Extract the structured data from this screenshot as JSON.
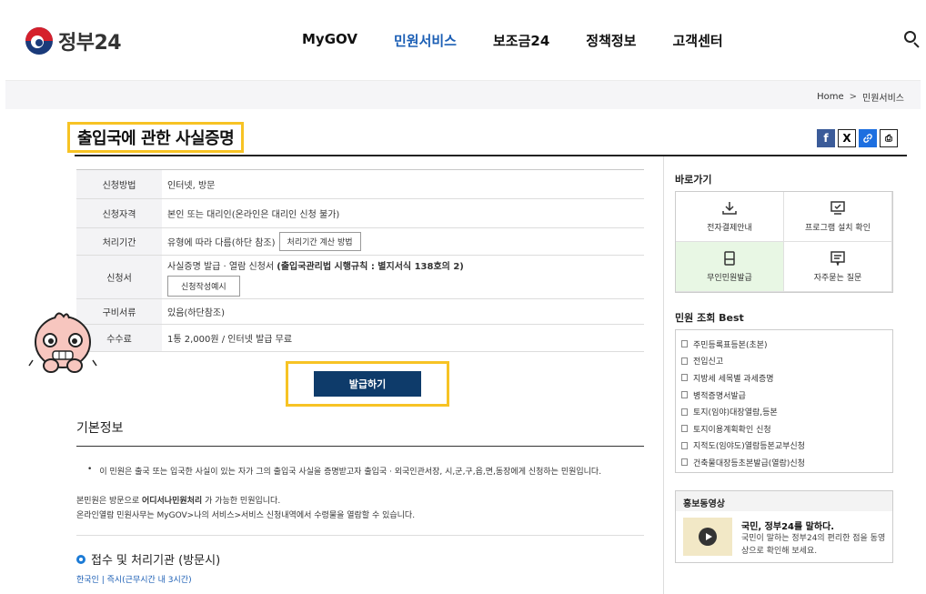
{
  "header": {
    "logo_text": "정부24",
    "nav": [
      "MyGOV",
      "민원서비스",
      "보조금24",
      "정책정보",
      "고객센터"
    ],
    "active_nav_index": 1
  },
  "breadcrumb": {
    "home": "Home",
    "separator": ">",
    "current": "민원서비스"
  },
  "page_title": "출입국에 관한 사실증명",
  "share": {
    "print": "⎙"
  },
  "info_table": {
    "method_label": "신청방법",
    "method_value": "인터넷, 방문",
    "qualification_label": "신청자격",
    "qualification_value": "본인 또는 대리인(온라인은 대리인 신청 불가)",
    "period_label": "처리기간",
    "period_value": "유형에 따라 다름(하단 참조)",
    "period_button": "처리기간 계산 방법",
    "form_label": "신청서",
    "form_value_prefix": "사실증명 발급 · 열람 신청서 ",
    "form_value_bold": "(출입국관리법 시행규칙 : 별지서식 138호의 2)",
    "form_button": "신청작성예시",
    "docs_label": "구비서류",
    "docs_value": "있음(하단참조)",
    "fee_label": "수수료",
    "fee_value": "1통 2,000원 / 인터넷 발급 무료"
  },
  "issue_button": "발급하기",
  "basic_info": {
    "title": "기본정보",
    "bullet": "이 민원은 출국 또는 입국한 사실이 있는 자가 그의 출입국 사실을 증명받고자 출입국 · 외국인관서장, 시,군,구,읍,면,동장에게 신청하는 민원입니다.",
    "note1_prefix": "본민원은 방문으로 ",
    "note1_bold": "어디서나민원처리",
    "note1_suffix": " 가 가능한 민원입니다.",
    "note2": "온라인열람 민원사무는 MyGOV>나의 서비스>서비스 신청내역에서 수령물을 열람할 수 있습니다."
  },
  "reception": {
    "title": "접수 및 처리기관 (방문시)",
    "text": "한국인 | 즉시(근무시간 내 3시간)"
  },
  "sidebar": {
    "shortcuts_title": "바로가기",
    "shortcuts": [
      "전자결제안내",
      "프로그램 설치 확인",
      "무인민원발급",
      "자주묻는 질문"
    ],
    "best_title": "민원 조회 Best",
    "best_items": [
      "주민등록표등본(초본)",
      "전입신고",
      "지방세 세목별 과세증명",
      "병적증명서발급",
      "토지(임야)대장열람,등본",
      "토지이용계획확인 신청",
      "지적도(임야도)열람등본교부신청",
      "건축물대장등초본발급(열람)신청"
    ],
    "promo_title": "홍보동영상",
    "promo_video_title": "국민, 정부24를 말하다.",
    "promo_video_desc": "국민이 말하는 정부24의 편리한 점을 동영상으로 확인해 보세요."
  }
}
